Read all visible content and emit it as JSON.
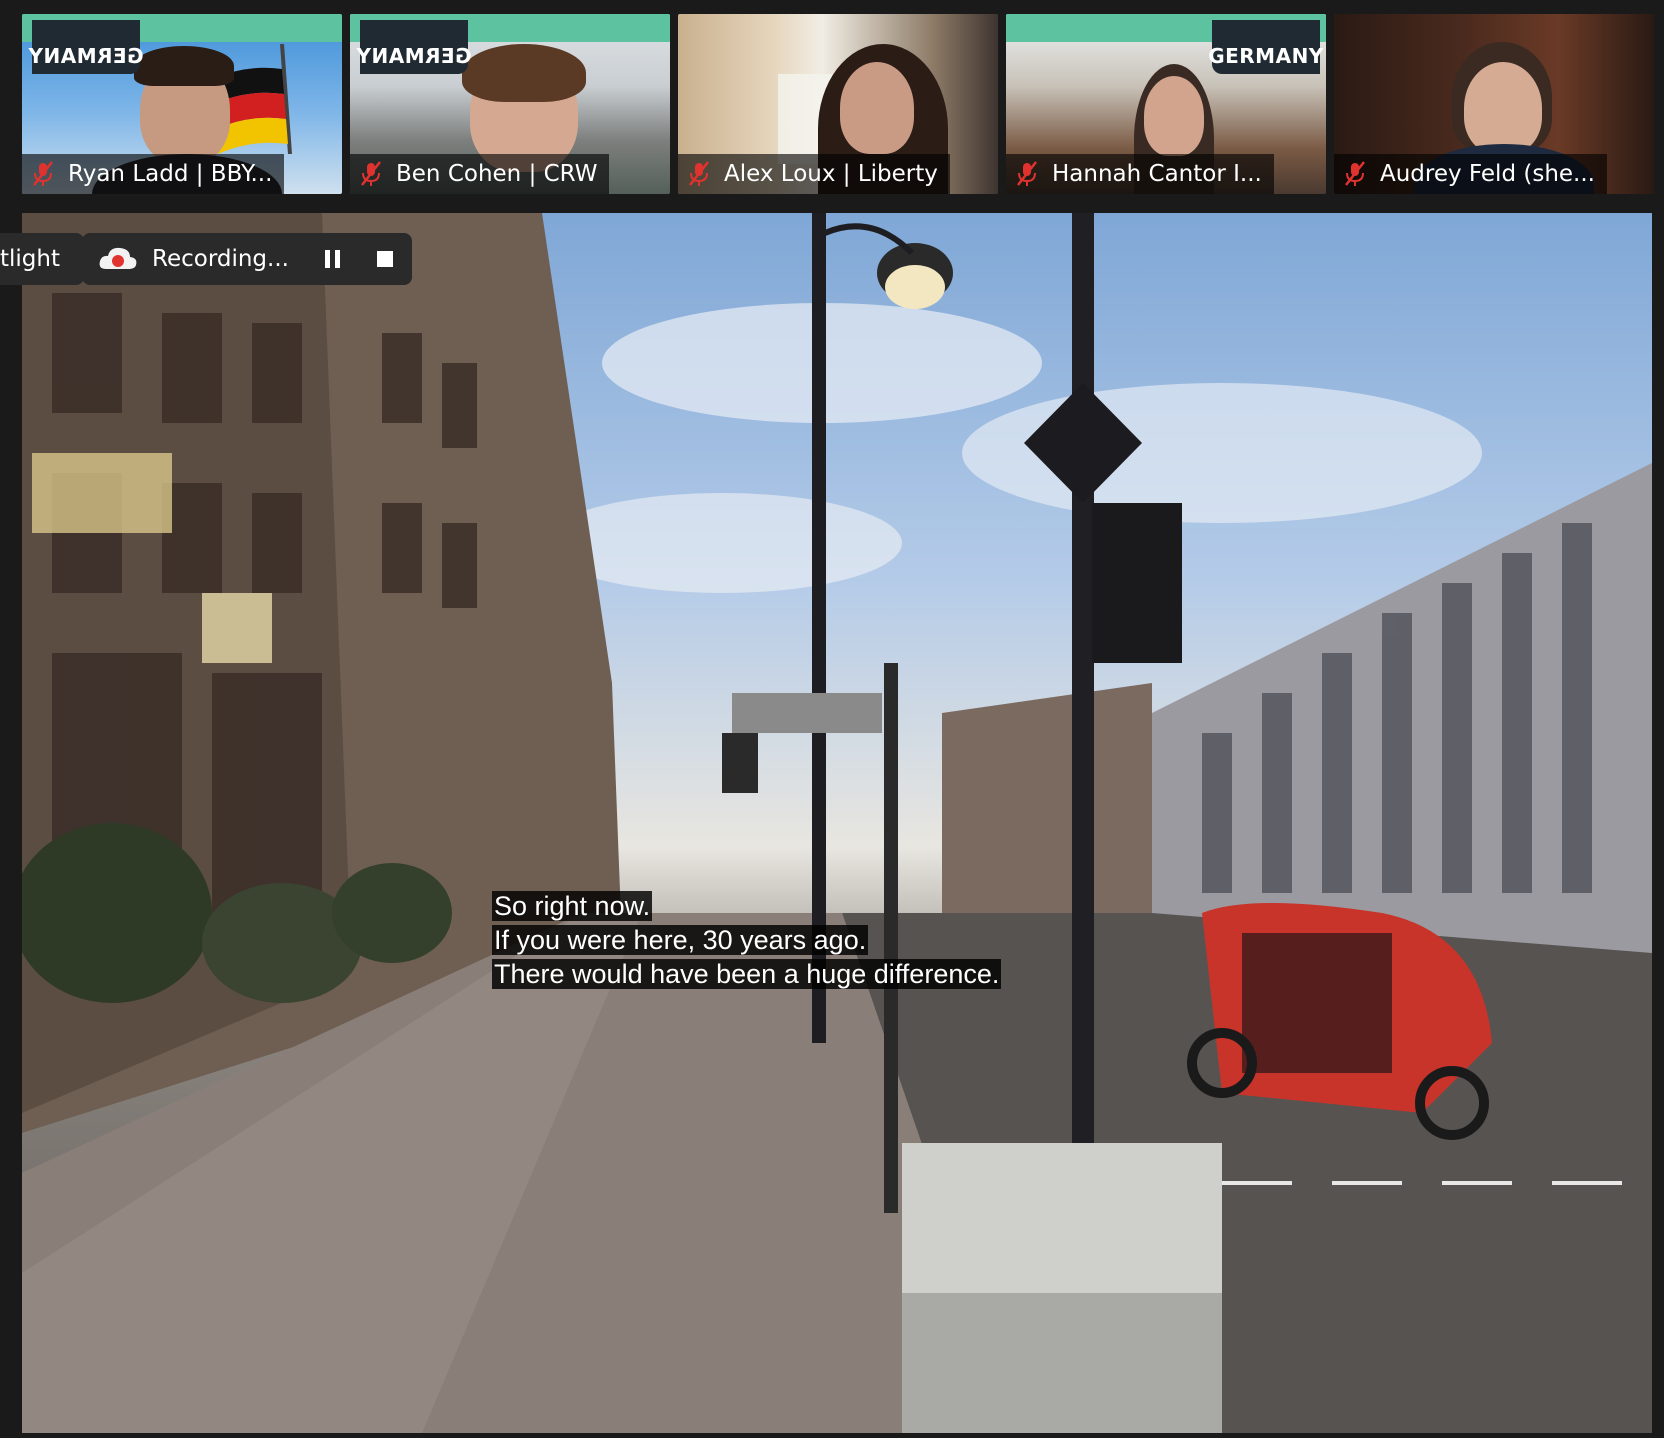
{
  "participants": [
    {
      "name": "Ryan Ladd | BBY...",
      "badge": "GERMANY",
      "badge_mirrored": true,
      "muted": true
    },
    {
      "name": "Ben Cohen | CRW",
      "badge": "GERMANY",
      "badge_mirrored": true,
      "muted": true
    },
    {
      "name": "Alex Loux | Liberty",
      "badge": "",
      "badge_mirrored": false,
      "muted": true
    },
    {
      "name": "Hannah Cantor I...",
      "badge": "GERMANY",
      "badge_mirrored": false,
      "muted": true
    },
    {
      "name": "Audrey Feld (she...",
      "badge": "",
      "badge_mirrored": false,
      "muted": true
    }
  ],
  "toolbar": {
    "spotlight_label": "tlight",
    "recording_label": "Recording...",
    "pause_icon": "pause-icon",
    "stop_icon": "stop-icon"
  },
  "captions": [
    "So right now.",
    "If you were here, 30 years ago.",
    "There would have been a huge difference."
  ],
  "colors": {
    "banner": "#5cc2a0",
    "mute_red": "#e0322e",
    "recording_red": "#e0322e",
    "pill_bg": "#2a2a2a"
  }
}
